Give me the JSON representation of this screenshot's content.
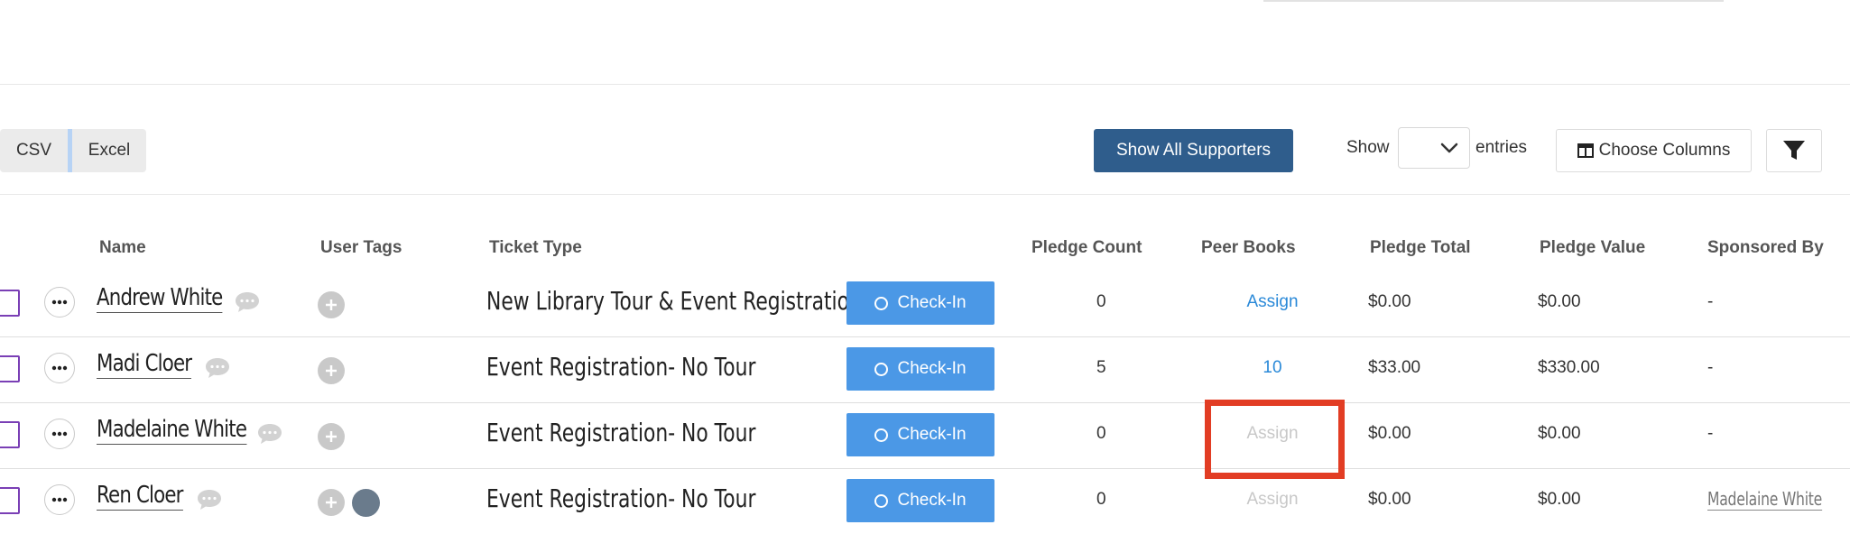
{
  "toolbar": {
    "csv_label": "CSV",
    "excel_label": "Excel",
    "show_all_label": "Show All Supporters",
    "show_label": "Show",
    "entries_value": "",
    "entries_label": "entries",
    "choose_columns_label": "Choose Columns"
  },
  "table": {
    "headers": [
      "Name",
      "User Tags",
      "Ticket Type",
      "Pledge Count",
      "Peer Books",
      "Pledge Total",
      "Pledge Value",
      "Sponsored By"
    ],
    "checkin_label": "Check-In",
    "rows": [
      {
        "name": "Andrew White",
        "ticket_type": "New Library Tour & Event Registration",
        "pledge_count": "0",
        "peer_books": "Assign",
        "pledge_total": "$0.00",
        "pledge_value": "$0.00",
        "sponsored_by": "-"
      },
      {
        "name": "Madi Cloer",
        "ticket_type": "Event Registration- No Tour",
        "pledge_count": "5",
        "peer_books": "10",
        "pledge_total": "$33.00",
        "pledge_value": "$330.00",
        "sponsored_by": "-"
      },
      {
        "name": "Madelaine White",
        "ticket_type": "Event Registration- No Tour",
        "pledge_count": "0",
        "peer_books": "Assign",
        "pledge_total": "$0.00",
        "pledge_value": "$0.00",
        "sponsored_by": "-"
      },
      {
        "name": "Ren Cloer",
        "ticket_type": "Event Registration- No Tour",
        "pledge_count": "0",
        "peer_books": "Assign",
        "pledge_total": "$0.00",
        "pledge_value": "$0.00",
        "sponsored_by": "Madelaine White"
      }
    ]
  },
  "colors": {
    "primary_button": "#2f5d8c",
    "checkin_button": "#4b98e6",
    "link": "#2a89d8",
    "highlight": "#e23d24",
    "checkbox_border": "#7a3fb5"
  },
  "icons": [
    "ellipsis-icon",
    "comment-icon",
    "plus-icon",
    "columns-icon",
    "filter-icon",
    "chevron-down-icon",
    "circle-icon"
  ]
}
